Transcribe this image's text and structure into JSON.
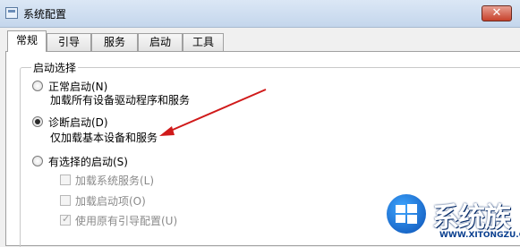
{
  "window": {
    "title": "系统配置",
    "close_label": "✕"
  },
  "tabs": [
    "常规",
    "引导",
    "服务",
    "启动",
    "工具"
  ],
  "startup_group": {
    "label": "启动选择",
    "options": [
      {
        "label": "正常启动(N)",
        "desc": "加载所有设备驱动程序和服务",
        "checked": false
      },
      {
        "label": "诊断启动(D)",
        "desc": "仅加载基本设备和服务",
        "checked": true
      },
      {
        "label": "有选择的启动(S)",
        "checked": false
      }
    ],
    "sub_options": [
      {
        "label": "加载系统服务(L)",
        "checked": false
      },
      {
        "label": "加载启动项(O)",
        "checked": false
      },
      {
        "label": "使用原有引导配置(U)",
        "checked": true
      }
    ]
  },
  "annotation": {
    "arrow_color": "#d01a1a"
  },
  "watermark": {
    "brand": "系统族",
    "url": "WWW.XITONGZU.COM"
  }
}
